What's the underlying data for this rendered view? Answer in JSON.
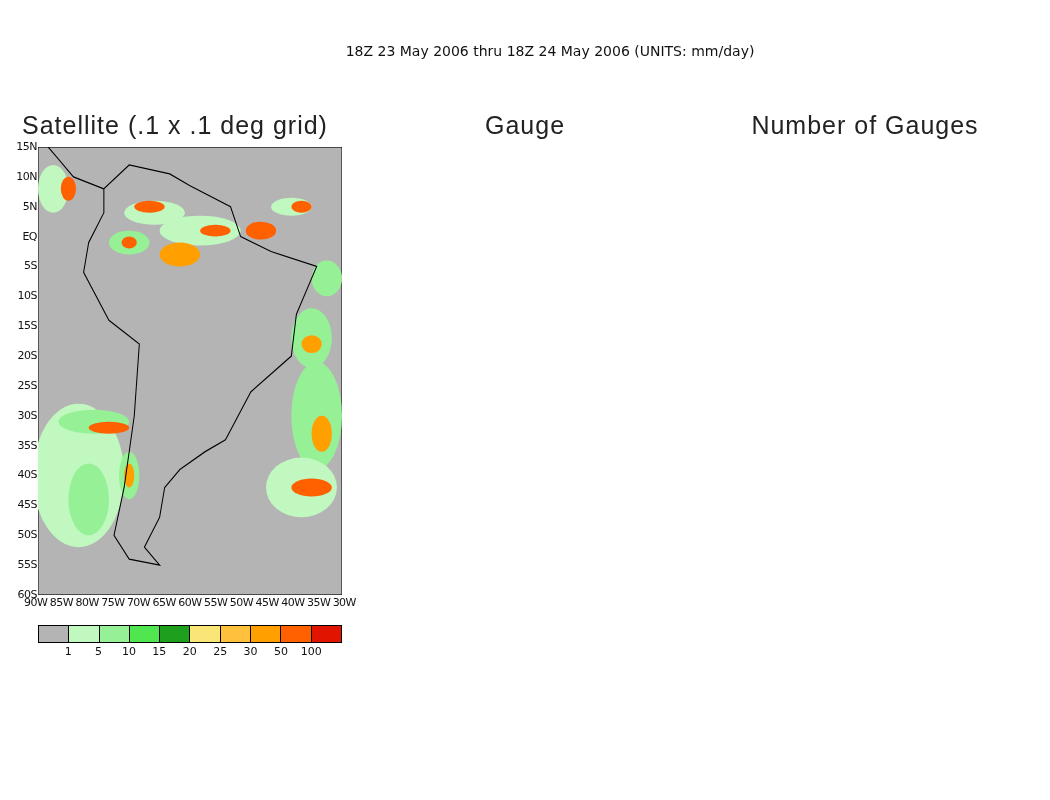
{
  "subtitle": "18Z 23 May 2006 thru 18Z 24 May 2006 (UNITS: mm/day)",
  "panels": [
    {
      "title": "Satellite (.1 x .1 deg grid)",
      "kind": "map"
    },
    {
      "title": "Gauge",
      "kind": "empty"
    },
    {
      "title": "Number of Gauges",
      "kind": "empty"
    }
  ],
  "map": {
    "lat_labels": [
      "15N",
      "10N",
      "5N",
      "EQ",
      "5S",
      "10S",
      "15S",
      "20S",
      "25S",
      "30S",
      "35S",
      "40S",
      "45S",
      "50S",
      "55S",
      "60S"
    ],
    "lon_labels": [
      "90W",
      "85W",
      "80W",
      "75W",
      "70W",
      "65W",
      "60W",
      "55W",
      "50W",
      "45W",
      "40W",
      "35W",
      "30W"
    ]
  },
  "colorbar": {
    "swatches": [
      {
        "color": "#b4b4b4"
      },
      {
        "color": "#c0f8c0"
      },
      {
        "color": "#96f096"
      },
      {
        "color": "#50e650"
      },
      {
        "color": "#1ea01e"
      },
      {
        "color": "#fae678"
      },
      {
        "color": "#ffc03c"
      },
      {
        "color": "#ffa000"
      },
      {
        "color": "#ff6000"
      },
      {
        "color": "#e11400"
      }
    ],
    "labels": [
      "1",
      "5",
      "10",
      "15",
      "20",
      "25",
      "30",
      "50",
      "100"
    ]
  }
}
